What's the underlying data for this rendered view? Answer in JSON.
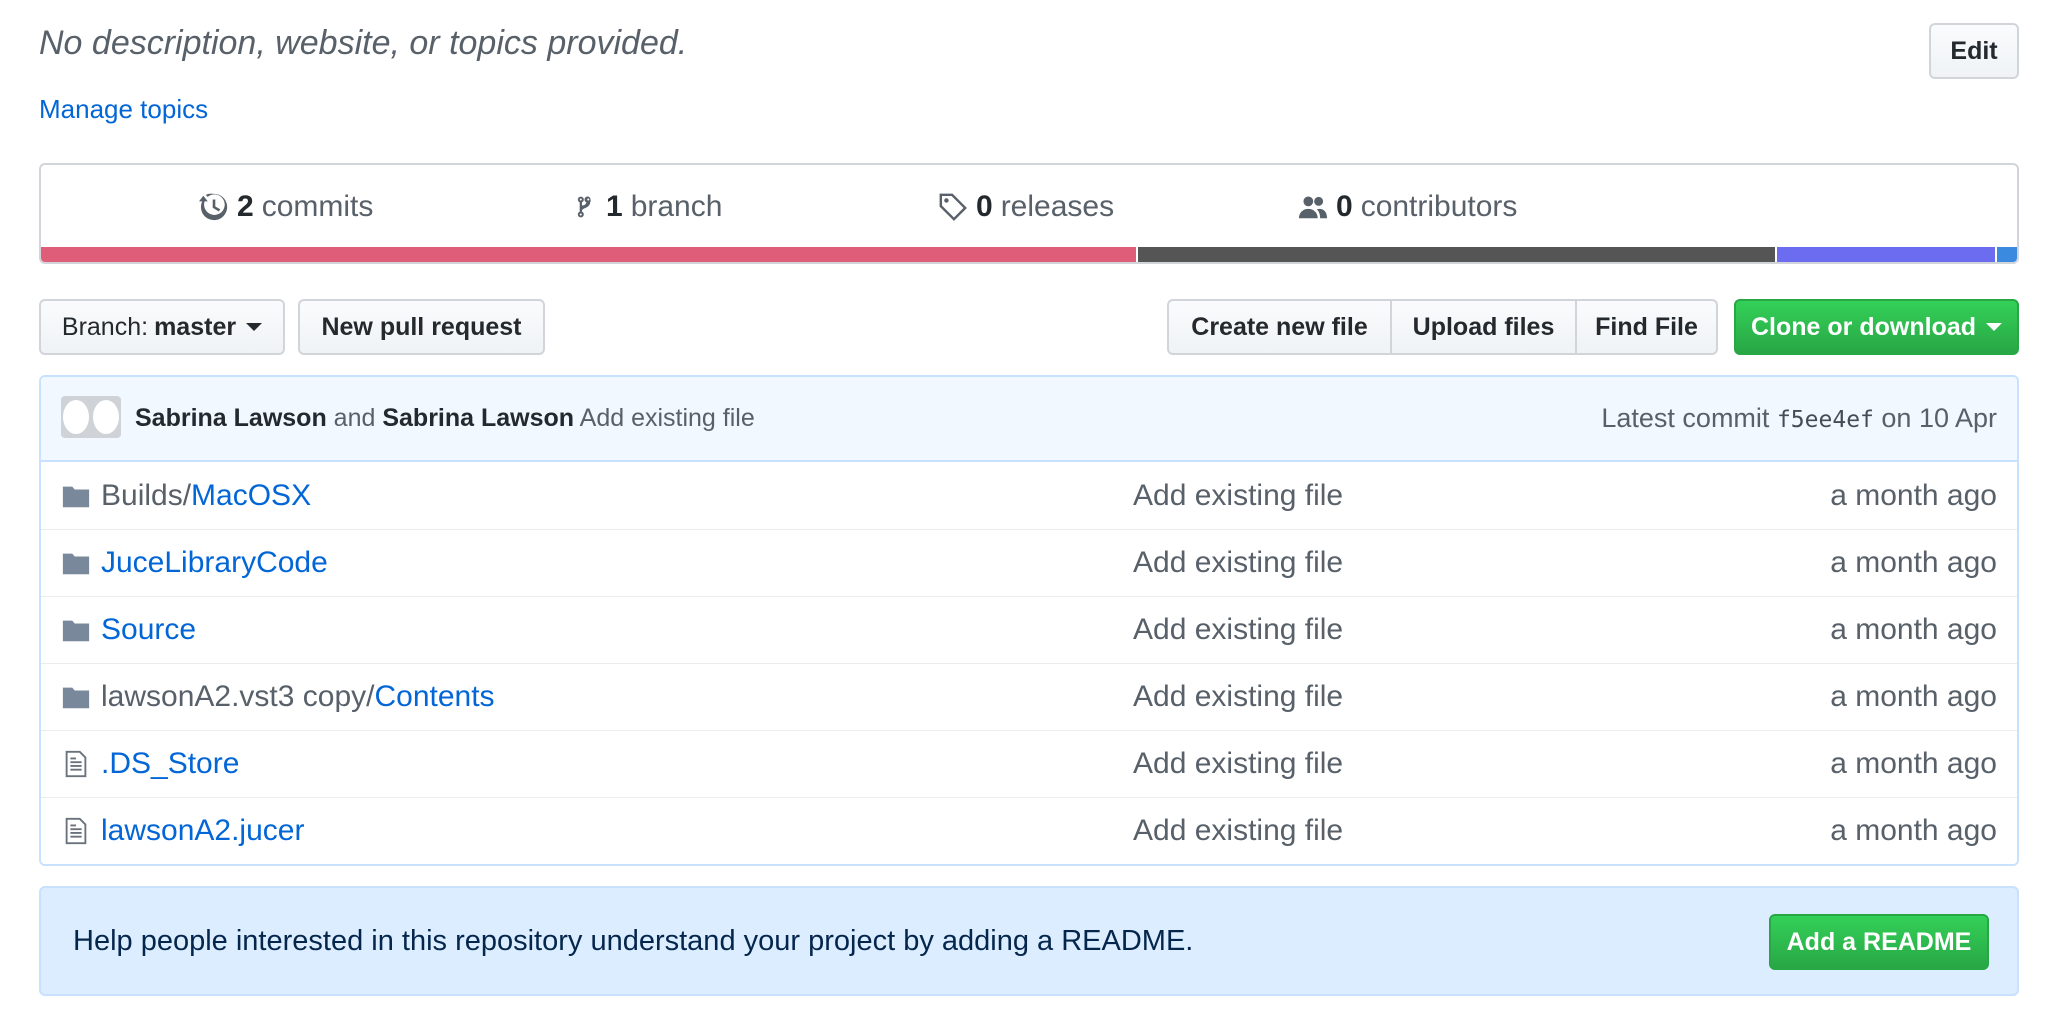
{
  "header": {
    "description": "No description, website, or topics provided.",
    "edit_label": "Edit",
    "manage_topics_label": "Manage topics"
  },
  "summary": {
    "commits": {
      "count": "2",
      "label": "commits"
    },
    "branches": {
      "count": "1",
      "label": "branch"
    },
    "releases": {
      "count": "0",
      "label": "releases"
    },
    "contributors": {
      "count": "0",
      "label": "contributors"
    },
    "languages": [
      {
        "color": "#e05d7a",
        "share": 0.556
      },
      {
        "color": "#555555",
        "share": 0.323
      },
      {
        "color": "#6c6cf0",
        "share": 0.111
      },
      {
        "color": "#3a8be0",
        "share": 0.01
      }
    ]
  },
  "toolbar": {
    "branch_prefix": "Branch:",
    "branch_name": "master",
    "new_pr_label": "New pull request",
    "create_file_label": "Create new file",
    "upload_files_label": "Upload files",
    "find_file_label": "Find File",
    "clone_label": "Clone or download"
  },
  "commit": {
    "author1": "Sabrina Lawson",
    "conjunction": "and",
    "author2": "Sabrina Lawson",
    "message": "Add existing file",
    "latest_prefix": "Latest commit",
    "sha": "f5ee4ef",
    "date": "on 10 Apr"
  },
  "files": [
    {
      "type": "folder",
      "prefix": "Builds/",
      "name": "MacOSX",
      "message": "Add existing file",
      "age": "a month ago"
    },
    {
      "type": "folder",
      "prefix": "",
      "name": "JuceLibraryCode",
      "message": "Add existing file",
      "age": "a month ago"
    },
    {
      "type": "folder",
      "prefix": "",
      "name": "Source",
      "message": "Add existing file",
      "age": "a month ago"
    },
    {
      "type": "folder",
      "prefix": "lawsonA2.vst3 copy/",
      "name": "Contents",
      "message": "Add existing file",
      "age": "a month ago"
    },
    {
      "type": "file",
      "prefix": "",
      "name": ".DS_Store",
      "message": "Add existing file",
      "age": "a month ago"
    },
    {
      "type": "file",
      "prefix": "",
      "name": "lawsonA2.jucer",
      "message": "Add existing file",
      "age": "a month ago"
    }
  ],
  "readme": {
    "text": "Help people interested in this repository understand your project by adding a README.",
    "button_label": "Add a README"
  }
}
